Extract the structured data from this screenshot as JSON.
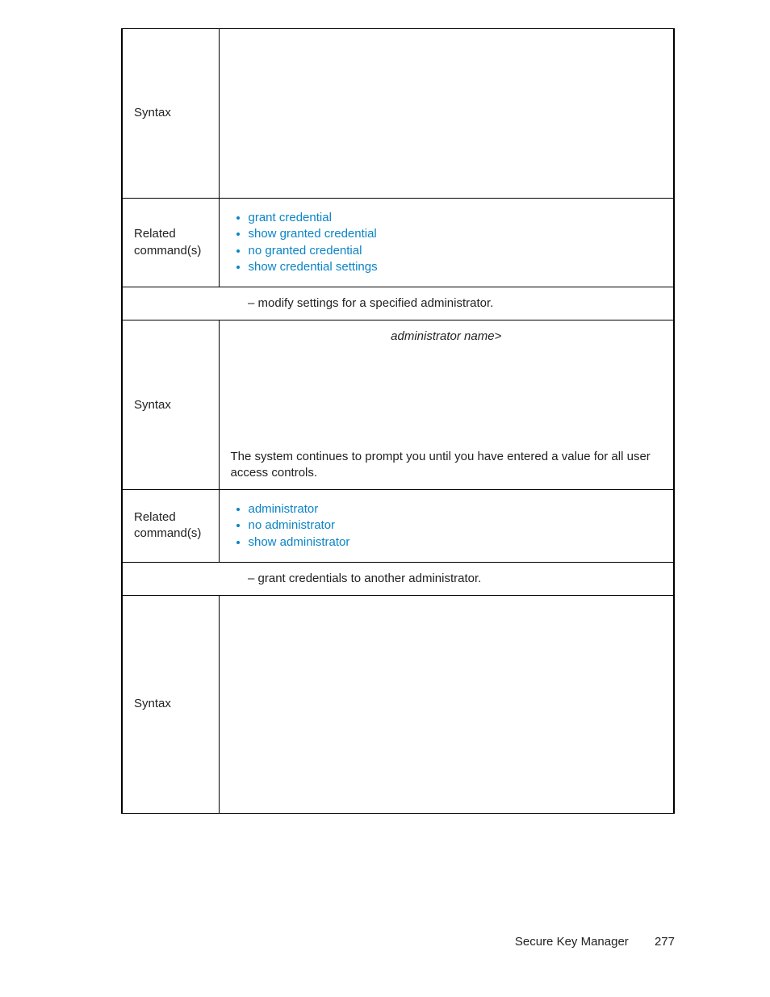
{
  "rows": {
    "syntax1_label": "Syntax",
    "related1_label": "Related command(s)",
    "related1_items": [
      "grant credential",
      "show granted credential",
      "no granted credential",
      "show credential settings"
    ],
    "sep1": "– modify settings for a specified administrator.",
    "syntax2_label": "Syntax",
    "admin_name_line": "administrator name>",
    "syntax2_note": "The system continues to prompt you until you have entered a value for all user access controls.",
    "related2_label": "Related command(s)",
    "related2_items": [
      "administrator",
      "no administrator",
      "show administrator"
    ],
    "sep2": "– grant credentials to another administrator.",
    "syntax3_label": "Syntax"
  },
  "footer": {
    "title": "Secure Key Manager",
    "page": "277"
  }
}
